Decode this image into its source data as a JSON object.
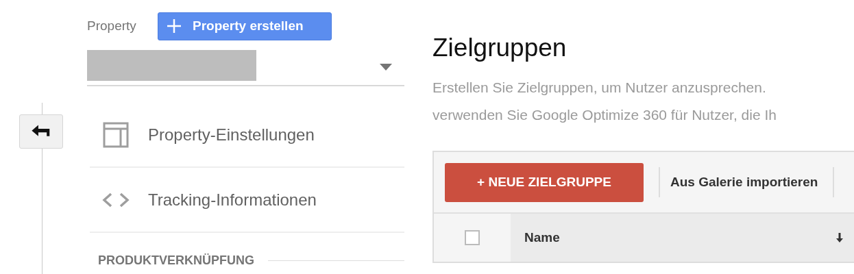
{
  "property_selector": {
    "label": "Property",
    "create_button": "Property erstellen"
  },
  "nav_items": [
    {
      "kind": "layout",
      "label": "Property-Einstellungen"
    },
    {
      "kind": "code",
      "label": "Tracking-Informationen"
    }
  ],
  "section_heading": "PRODUKTVERKNÜPFUNG",
  "page": {
    "title": "Zielgruppen",
    "description_lines": [
      "Erstellen Sie Zielgruppen, um Nutzer anzusprechen.",
      "verwenden Sie Google Optimize 360 für Nutzer, die Ih"
    ]
  },
  "toolbar": {
    "new_button": "+ NEUE ZIELGRUPPE",
    "import_link": "Aus Galerie importieren"
  },
  "table": {
    "select_all_checked": false,
    "columns": [
      {
        "label": "Name",
        "sorted_descending": true
      }
    ]
  }
}
